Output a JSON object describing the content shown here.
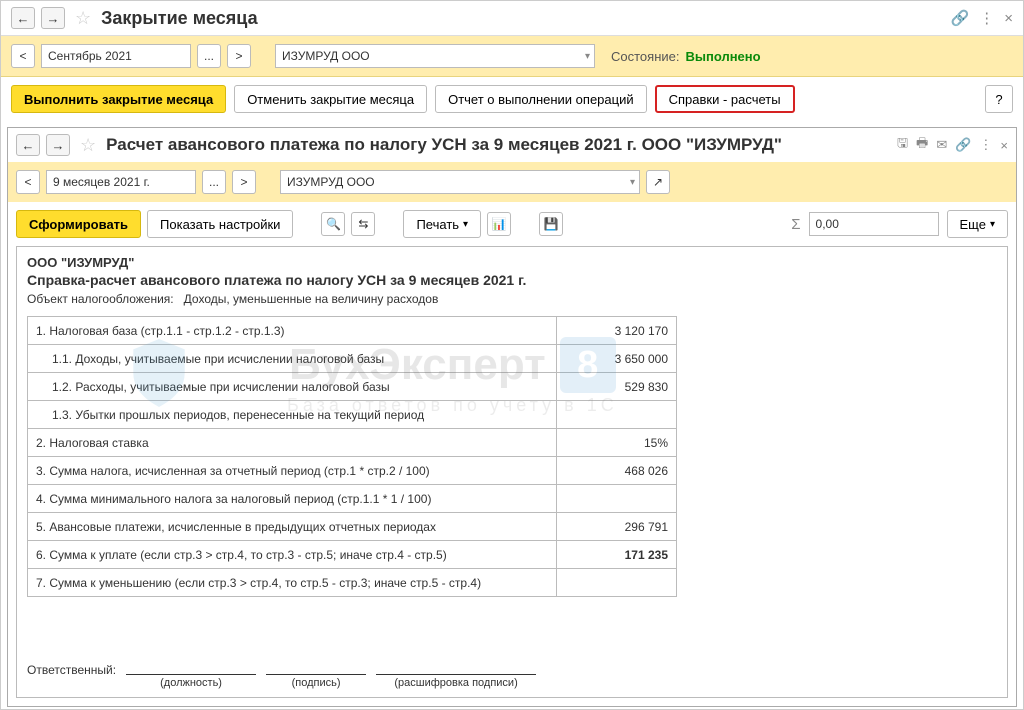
{
  "top": {
    "title": "Закрытие месяца",
    "period": "Сентябрь 2021",
    "org": "ИЗУМРУД ООО",
    "state_label": "Состояние:",
    "state_value": "Выполнено"
  },
  "toolbar": {
    "execute": "Выполнить закрытие месяца",
    "cancel": "Отменить закрытие месяца",
    "report": "Отчет о выполнении операций",
    "refs": "Справки - расчеты",
    "help": "?"
  },
  "inner": {
    "title": "Расчет  авансового платежа по налогу УСН за 9 месяцев 2021 г. ООО \"ИЗУМРУД\"",
    "period": "9 месяцев 2021 г.",
    "org": "ИЗУМРУД ООО",
    "form": "Сформировать",
    "show_settings": "Показать настройки",
    "print": "Печать",
    "sum": "0,00",
    "more": "Еще"
  },
  "report": {
    "company": "ООО \"ИЗУМРУД\"",
    "heading": "Справка-расчет авансового платежа по налогу УСН за 9 месяцев 2021 г.",
    "obj_label": "Объект налогообложения:",
    "obj_value": "Доходы, уменьшенные на величину расходов",
    "rows": [
      {
        "label": "1. Налоговая база (стр.1.1 - стр.1.2 - стр.1.3)",
        "value": "3 120 170",
        "indent": false,
        "bold": false
      },
      {
        "label": "1.1. Доходы, учитываемые при исчислении налоговой базы",
        "value": "3 650 000",
        "indent": true,
        "bold": false
      },
      {
        "label": "1.2. Расходы, учитываемые при исчислении налоговой базы",
        "value": "529 830",
        "indent": true,
        "bold": false
      },
      {
        "label": "1.3. Убытки прошлых периодов, перенесенные на текущий период",
        "value": "",
        "indent": true,
        "bold": false
      },
      {
        "label": "2. Налоговая ставка",
        "value": "15%",
        "indent": false,
        "bold": false
      },
      {
        "label": "3. Сумма налога, исчисленная за отчетный период (стр.1 * стр.2 / 100)",
        "value": "468 026",
        "indent": false,
        "bold": false
      },
      {
        "label": "4. Сумма минимального налога за налоговый период (стр.1.1 * 1 / 100)",
        "value": "",
        "indent": false,
        "bold": false
      },
      {
        "label": "5. Авансовые платежи, исчисленные в предыдущих отчетных периодах",
        "value": "296 791",
        "indent": false,
        "bold": false
      },
      {
        "label": "6. Сумма к уплате (если стр.3 > стр.4, то стр.3 - стр.5; иначе стр.4 - стр.5)",
        "value": "171 235",
        "indent": false,
        "bold": true
      },
      {
        "label": "7. Сумма к уменьшению (если стр.3 > стр.4, то стр.5 - стр.3; иначе стр.5 - стр.4)",
        "value": "",
        "indent": false,
        "bold": false
      }
    ],
    "sign": {
      "label": "Ответственный:",
      "position": "(должность)",
      "signature": "(подпись)",
      "decipher": "(расшифровка подписи)"
    }
  },
  "watermark": {
    "main": "БухЭксперт",
    "badge": "8",
    "sub": "База ответов по учету в 1С"
  }
}
